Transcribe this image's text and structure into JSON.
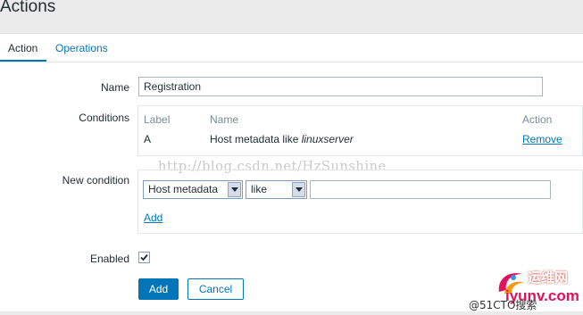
{
  "page": {
    "title": "Actions"
  },
  "tabs": [
    {
      "label": "Action",
      "active": true
    },
    {
      "label": "Operations",
      "active": false
    }
  ],
  "form": {
    "name_label": "Name",
    "name_value": "Registration",
    "conditions_label": "Conditions",
    "conditions": {
      "headers": {
        "label": "Label",
        "name": "Name",
        "action": "Action"
      },
      "rows": [
        {
          "label": "A",
          "name_prefix": "Host metadata like ",
          "name_value": "linuxserver",
          "action": "Remove"
        }
      ]
    },
    "new_condition_label": "New condition",
    "new_condition": {
      "type_selected": "Host metadata",
      "operator_selected": "like",
      "value": "",
      "add_label": "Add"
    },
    "enabled_label": "Enabled",
    "enabled": true,
    "buttons": {
      "add": "Add",
      "cancel": "Cancel"
    }
  },
  "watermark": "http://blog.csdn.net/HzSunshine",
  "site_logo": {
    "name_cn": "运维网",
    "url": "iyunv.com",
    "sub": "@51CTO搜索"
  },
  "colors": {
    "accent": "#0275b8",
    "text": "#1f2c33",
    "muted": "#768d99",
    "background": "#ebebeb"
  }
}
